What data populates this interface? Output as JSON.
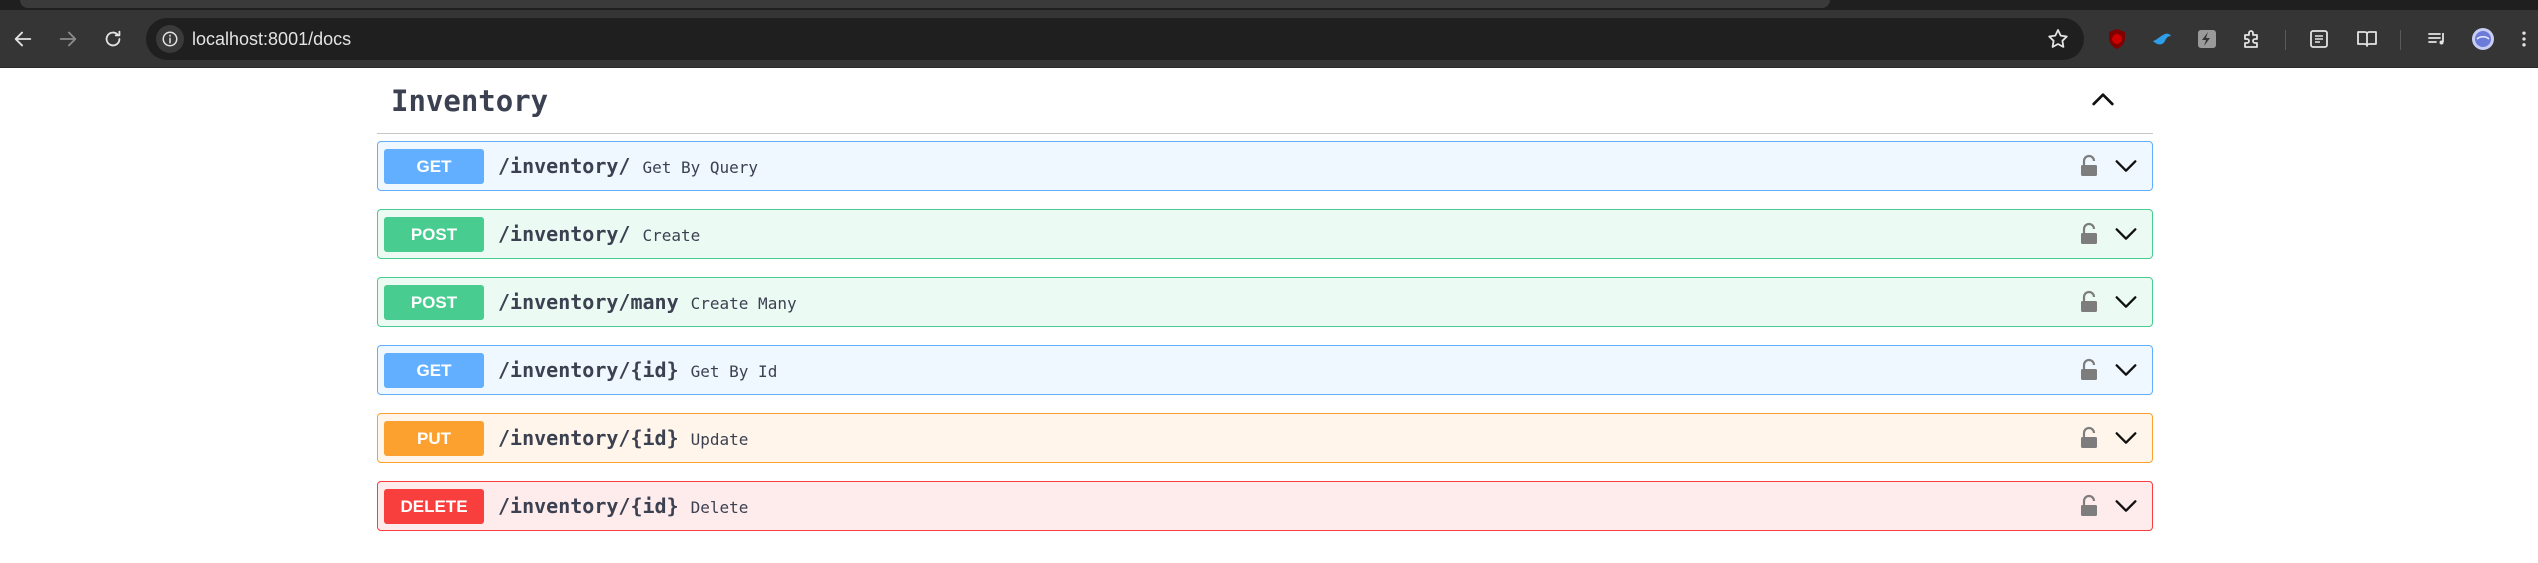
{
  "browser": {
    "url": "localhost:8001/docs"
  },
  "section": {
    "title": "Inventory"
  },
  "operations": [
    {
      "method": "GET",
      "path": "/inventory/",
      "summary": "Get By Query"
    },
    {
      "method": "POST",
      "path": "/inventory/",
      "summary": "Create"
    },
    {
      "method": "POST",
      "path": "/inventory/many",
      "summary": "Create Many"
    },
    {
      "method": "GET",
      "path": "/inventory/{id}",
      "summary": "Get By Id"
    },
    {
      "method": "PUT",
      "path": "/inventory/{id}",
      "summary": "Update"
    },
    {
      "method": "DELETE",
      "path": "/inventory/{id}",
      "summary": "Delete"
    }
  ],
  "colors": {
    "get": "#61affe",
    "post": "#49cc90",
    "put": "#fca130",
    "delete": "#f93e3e",
    "text": "#3b4151"
  },
  "icons": {
    "back": "back-arrow-icon",
    "forward": "forward-arrow-icon",
    "reload": "reload-icon",
    "site_info": "site-info-icon",
    "bookmark": "star-icon",
    "lock": "lock-icon",
    "expand": "chevron-down-icon",
    "collapse": "chevron-up-icon"
  }
}
